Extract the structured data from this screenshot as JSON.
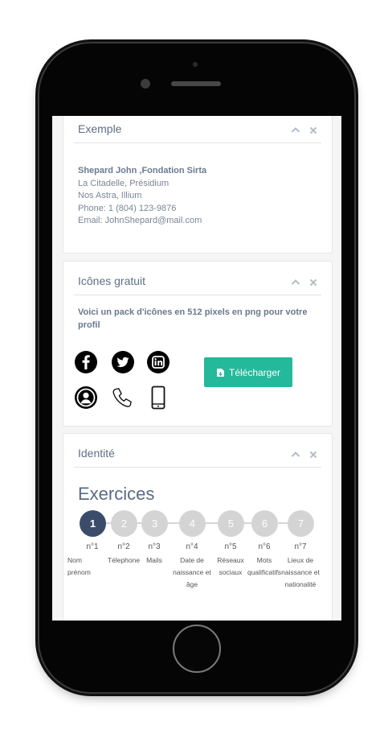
{
  "panels": {
    "exemple": {
      "title": "Exemple",
      "contact": {
        "name_line": "Shepard John ,Fondation Sirta",
        "line1": "La Citadelle, Présidium",
        "line2": "Nos Astra, Illium",
        "phone": "Phone: 1 (804) 123-9876",
        "email": "Email: JohnShepard@mail.com"
      }
    },
    "icones": {
      "title": "Icônes gratuit",
      "description": "Voici un pack d'icônes en 512 pixels en png pour votre profil",
      "icons": [
        "facebook-icon",
        "twitter-icon",
        "linkedin-icon",
        "user-icon",
        "phone-icon",
        "mobile-icon"
      ],
      "download_label": "Télécharger"
    },
    "identite": {
      "title": "Identité",
      "exercise_title": "Exercices",
      "steps": [
        {
          "num": "1",
          "code": "n°1",
          "label": "Nom prénom"
        },
        {
          "num": "2",
          "code": "n°2",
          "label": "Télephone"
        },
        {
          "num": "3",
          "code": "n°3",
          "label": "Mails"
        },
        {
          "num": "4",
          "code": "n°4",
          "label": "Date de naissance et âge"
        },
        {
          "num": "5",
          "code": "n°5",
          "label": "Réseaux sociaux"
        },
        {
          "num": "6",
          "code": "n°6",
          "label": "Mots qualificatifs"
        },
        {
          "num": "7",
          "code": "n°7",
          "label": "Lieux de naissance et nationalité"
        }
      ],
      "active_step": 1
    }
  },
  "colors": {
    "accent": "#23b99a",
    "active_step": "#3b4c6b",
    "inactive_step": "#d4d4d4",
    "title_text": "#5f6f86"
  }
}
